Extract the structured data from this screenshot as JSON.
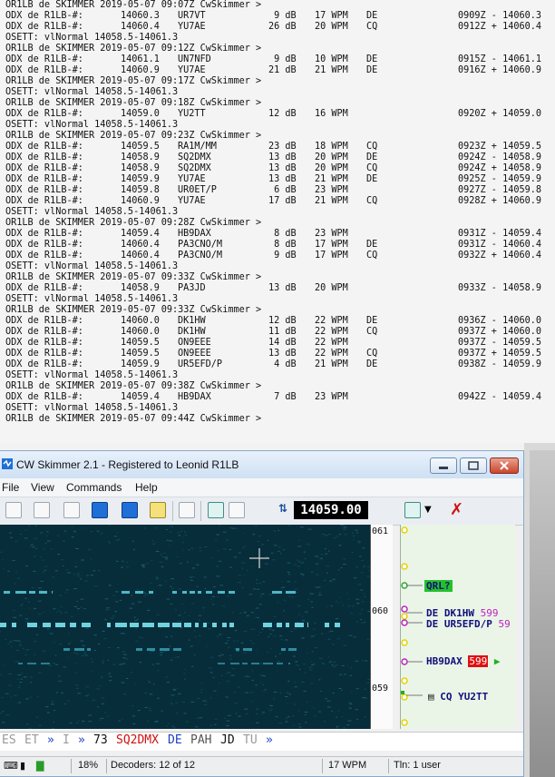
{
  "terminal": {
    "lines": [
      {
        "type": "h",
        "a": "OR1LB de SKIMMER 2019-05-07 09:07Z CwSkimmer >"
      },
      {
        "type": "s",
        "a": "ODX de R1LB-#:",
        "f": "14060.3",
        "c": "UR7VT",
        "db": "9",
        "w": "17",
        "m": "DE",
        "t": "0909Z - 14060.3"
      },
      {
        "type": "s",
        "a": "ODX de R1LB-#:",
        "f": "14060.4",
        "c": "YU7AE",
        "db": "26",
        "w": "20",
        "m": "CQ",
        "t": "0912Z + 14060.4"
      },
      {
        "type": "h",
        "a": "OSETT: vlNormal 14058.5-14061.3"
      },
      {
        "type": "h",
        "a": "OR1LB de SKIMMER 2019-05-07 09:12Z CwSkimmer >"
      },
      {
        "type": "s",
        "a": "ODX de R1LB-#:",
        "f": "14061.1",
        "c": "UN7NFD",
        "db": "9",
        "w": "10",
        "m": "DE",
        "t": "0915Z - 14061.1"
      },
      {
        "type": "s",
        "a": "ODX de R1LB-#:",
        "f": "14060.9",
        "c": "YU7AE",
        "db": "21",
        "w": "21",
        "m": "DE",
        "t": "0916Z + 14060.9"
      },
      {
        "type": "h",
        "a": "OR1LB de SKIMMER 2019-05-07 09:17Z CwSkimmer >"
      },
      {
        "type": "h",
        "a": "OSETT: vlNormal 14058.5-14061.3"
      },
      {
        "type": "h",
        "a": "OR1LB de SKIMMER 2019-05-07 09:18Z CwSkimmer >"
      },
      {
        "type": "s",
        "a": "ODX de R1LB-#:",
        "f": "14059.0",
        "c": "YU2TT",
        "db": "12",
        "w": "16",
        "m": "",
        "t": "0920Z + 14059.0"
      },
      {
        "type": "h",
        "a": "OSETT: vlNormal 14058.5-14061.3"
      },
      {
        "type": "h",
        "a": "OR1LB de SKIMMER 2019-05-07 09:23Z CwSkimmer >"
      },
      {
        "type": "s",
        "a": "ODX de R1LB-#:",
        "f": "14059.5",
        "c": "RA1M/MM",
        "db": "23",
        "w": "18",
        "m": "CQ",
        "t": "0923Z + 14059.5"
      },
      {
        "type": "s",
        "a": "ODX de R1LB-#:",
        "f": "14058.9",
        "c": "SQ2DMX",
        "db": "13",
        "w": "20",
        "m": "DE",
        "t": "0924Z - 14058.9"
      },
      {
        "type": "s",
        "a": "ODX de R1LB-#:",
        "f": "14058.9",
        "c": "SQ2DMX",
        "db": "13",
        "w": "20",
        "m": "CQ",
        "t": "0924Z + 14058.9"
      },
      {
        "type": "s",
        "a": "ODX de R1LB-#:",
        "f": "14059.9",
        "c": "YU7AE",
        "db": "13",
        "w": "21",
        "m": "DE",
        "t": "0925Z - 14059.9"
      },
      {
        "type": "s",
        "a": "ODX de R1LB-#:",
        "f": "14059.8",
        "c": "UR0ET/P",
        "db": "6",
        "w": "23",
        "m": "",
        "t": "0927Z - 14059.8"
      },
      {
        "type": "s",
        "a": "ODX de R1LB-#:",
        "f": "14060.9",
        "c": "YU7AE",
        "db": "17",
        "w": "21",
        "m": "CQ",
        "t": "0928Z + 14060.9"
      },
      {
        "type": "h",
        "a": "OSETT: vlNormal 14058.5-14061.3"
      },
      {
        "type": "h",
        "a": "OR1LB de SKIMMER 2019-05-07 09:28Z CwSkimmer >"
      },
      {
        "type": "s",
        "a": "ODX de R1LB-#:",
        "f": "14059.4",
        "c": "HB9DAX",
        "db": "8",
        "w": "23",
        "m": "",
        "t": "0931Z - 14059.4"
      },
      {
        "type": "s",
        "a": "ODX de R1LB-#:",
        "f": "14060.4",
        "c": "PA3CNO/M",
        "db": "8",
        "w": "17",
        "m": "DE",
        "t": "0931Z - 14060.4"
      },
      {
        "type": "s",
        "a": "ODX de R1LB-#:",
        "f": "14060.4",
        "c": "PA3CNO/M",
        "db": "9",
        "w": "17",
        "m": "CQ",
        "t": "0932Z + 14060.4"
      },
      {
        "type": "h",
        "a": "OSETT: vlNormal 14058.5-14061.3"
      },
      {
        "type": "h",
        "a": "OR1LB de SKIMMER 2019-05-07 09:33Z CwSkimmer >"
      },
      {
        "type": "s",
        "a": "ODX de R1LB-#:",
        "f": "14058.9",
        "c": "PA3JD",
        "db": "13",
        "w": "20",
        "m": "",
        "t": "0933Z - 14058.9"
      },
      {
        "type": "h",
        "a": "OSETT: vlNormal 14058.5-14061.3"
      },
      {
        "type": "h",
        "a": "OR1LB de SKIMMER 2019-05-07 09:33Z CwSkimmer >"
      },
      {
        "type": "s",
        "a": "ODX de R1LB-#:",
        "f": "14060.0",
        "c": "DK1HW",
        "db": "12",
        "w": "22",
        "m": "DE",
        "t": "0936Z - 14060.0"
      },
      {
        "type": "s",
        "a": "ODX de R1LB-#:",
        "f": "14060.0",
        "c": "DK1HW",
        "db": "11",
        "w": "22",
        "m": "CQ",
        "t": "0937Z + 14060.0"
      },
      {
        "type": "s",
        "a": "ODX de R1LB-#:",
        "f": "14059.5",
        "c": "ON9EEE",
        "db": "14",
        "w": "22",
        "m": "",
        "t": "0937Z - 14059.5"
      },
      {
        "type": "s",
        "a": "ODX de R1LB-#:",
        "f": "14059.5",
        "c": "ON9EEE",
        "db": "13",
        "w": "22",
        "m": "CQ",
        "t": "0937Z + 14059.5"
      },
      {
        "type": "s",
        "a": "ODX de R1LB-#:",
        "f": "14059.9",
        "c": "UR5EFD/P",
        "db": "4",
        "w": "21",
        "m": "DE",
        "t": "0938Z - 14059.9"
      },
      {
        "type": "h",
        "a": "OSETT: vlNormal 14058.5-14061.3"
      },
      {
        "type": "h",
        "a": "OR1LB de SKIMMER 2019-05-07 09:38Z CwSkimmer >"
      },
      {
        "type": "s",
        "a": "ODX de R1LB-#:",
        "f": "14059.4",
        "c": "HB9DAX",
        "db": "7",
        "w": "23",
        "m": "",
        "t": "0942Z - 14059.4"
      },
      {
        "type": "h",
        "a": "OSETT: vlNormal 14058.5-14061.3"
      },
      {
        "type": "h",
        "a": "OR1LB de SKIMMER 2019-05-07 09:44Z CwSkimmer >"
      }
    ],
    "db_unit": "dB",
    "wpm_unit": "WPM"
  },
  "window": {
    "title": "CW Skimmer 2.1 - Registered to Leonid R1LB",
    "menu": [
      "File",
      "View",
      "Commands",
      "Help"
    ],
    "frequency": "14059.00",
    "scale_labels": [
      "061",
      "060",
      "059"
    ],
    "decodes": [
      {
        "text": "QRL?",
        "badge": ""
      },
      {
        "text": "DE DK1HW",
        "badge": "599"
      },
      {
        "text": "DE UR5EFD/P",
        "badge": "59"
      },
      {
        "text": "HB9DAX",
        "badge": "599"
      },
      {
        "text": "CQ YU2TT",
        "badge": ""
      }
    ],
    "decoder_text": [
      {
        "t": "ES",
        "c": "#999"
      },
      {
        "t": "ET",
        "c": "#999"
      },
      {
        "t": "»",
        "c": "#1a3fbf"
      },
      {
        "t": "I",
        "c": "#999"
      },
      {
        "t": "»",
        "c": "#1a3fbf"
      },
      {
        "t": "73",
        "c": "#111"
      },
      {
        "t": "SQ2DMX",
        "c": "#d01010"
      },
      {
        "t": "DE",
        "c": "#1a3fbf"
      },
      {
        "t": "PAH",
        "c": "#555"
      },
      {
        "t": "JD",
        "c": "#111"
      },
      {
        "t": "TU",
        "c": "#999"
      },
      {
        "t": "»",
        "c": "#1a3fbf"
      }
    ],
    "status": {
      "cpu": "18%",
      "decoders": "Decoders: 12 of 12",
      "wpm": "17 WPM",
      "telnet": "Tln: 1 user"
    }
  }
}
